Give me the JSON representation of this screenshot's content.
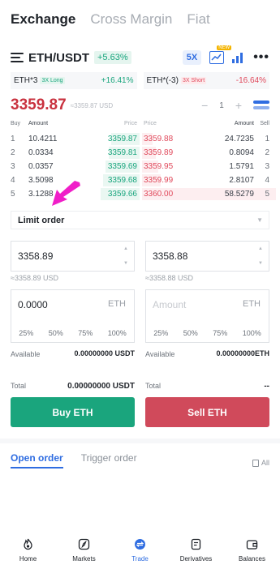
{
  "top_tabs": [
    {
      "label": "Exchange",
      "active": true
    },
    {
      "label": "Cross Margin",
      "active": false
    },
    {
      "label": "Fiat",
      "active": false
    }
  ],
  "pair": {
    "name": "ETH/USDT",
    "change": "+5.63%",
    "leverage": "5X",
    "new_badge": "NEW"
  },
  "etf": [
    {
      "name": "ETH*3",
      "tag": "3X Long",
      "change": "+16.41%"
    },
    {
      "name": "ETH*(-3)",
      "tag": "3X Short",
      "change": "-16.64%"
    }
  ],
  "last_price": {
    "value": "3359.87",
    "usd": "≈3359.87 USD",
    "precision_minus": "−",
    "precision_value": "1",
    "precision_plus": "+"
  },
  "orderbook": {
    "headers": {
      "buy": "Buy",
      "amount": "Amount",
      "price_bid": "Price",
      "price_ask": "Price",
      "amount_ask": "Amount",
      "sell": "Sell"
    },
    "rows": [
      {
        "n": "1",
        "bid_amt": "10.4211",
        "bid_price": "3359.87",
        "ask_price": "3359.88",
        "ask_amt": "24.7235",
        "n2": "1",
        "bid_depth": 0.22,
        "ask_depth": 0.08
      },
      {
        "n": "2",
        "bid_amt": "0.0334",
        "bid_price": "3359.81",
        "ask_price": "3359.89",
        "ask_amt": "0.8094",
        "n2": "2",
        "bid_depth": 0.24,
        "ask_depth": 0.1
      },
      {
        "n": "3",
        "bid_amt": "0.0357",
        "bid_price": "3359.69",
        "ask_price": "3359.95",
        "ask_amt": "1.5791",
        "n2": "3",
        "bid_depth": 0.26,
        "ask_depth": 0.12
      },
      {
        "n": "4",
        "bid_amt": "3.5098",
        "bid_price": "3359.68",
        "ask_price": "3359.99",
        "ask_amt": "2.8107",
        "n2": "4",
        "bid_depth": 0.28,
        "ask_depth": 0.14
      },
      {
        "n": "5",
        "bid_amt": "3.1288",
        "bid_price": "3359.66",
        "ask_price": "3360.00",
        "ask_amt": "58.5279",
        "n2": "5",
        "bid_depth": 0.3,
        "ask_depth": 1.0
      }
    ]
  },
  "order_type": {
    "selected": "Limit order"
  },
  "buy_form": {
    "price": "3358.89",
    "price_usd": "≈3358.89 USD",
    "amount": "0.0000",
    "unit": "ETH",
    "percents": [
      "25%",
      "50%",
      "75%",
      "100%"
    ],
    "available_label": "Available",
    "available_value": "0.00000000 USDT",
    "total_label": "Total",
    "total_value": "0.00000000 USDT",
    "button": "Buy ETH"
  },
  "sell_form": {
    "price": "3358.88",
    "price_usd": "≈3358.88 USD",
    "amount_placeholder": "Amount",
    "unit": "ETH",
    "percents": [
      "25%",
      "50%",
      "75%",
      "100%"
    ],
    "available_label": "Available",
    "available_value": "0.00000000ETH",
    "total_label": "Total",
    "total_value": "--",
    "button": "Sell ETH"
  },
  "order_tabs": {
    "tabs": [
      {
        "label": "Open order",
        "active": true
      },
      {
        "label": "Trigger order",
        "active": false
      }
    ],
    "all": "All"
  },
  "bottom_nav": [
    {
      "label": "Home",
      "icon": "flame-icon",
      "active": false
    },
    {
      "label": "Markets",
      "icon": "compass-icon",
      "active": false
    },
    {
      "label": "Trade",
      "icon": "trade-icon",
      "active": true
    },
    {
      "label": "Derivatives",
      "icon": "document-icon",
      "active": false
    },
    {
      "label": "Balances",
      "icon": "wallet-icon",
      "active": false
    }
  ],
  "colors": {
    "accent": "#2f6de1",
    "buy": "#1aa57d",
    "sell": "#d04a5b",
    "annotation_arrow": "#f01ec8"
  }
}
